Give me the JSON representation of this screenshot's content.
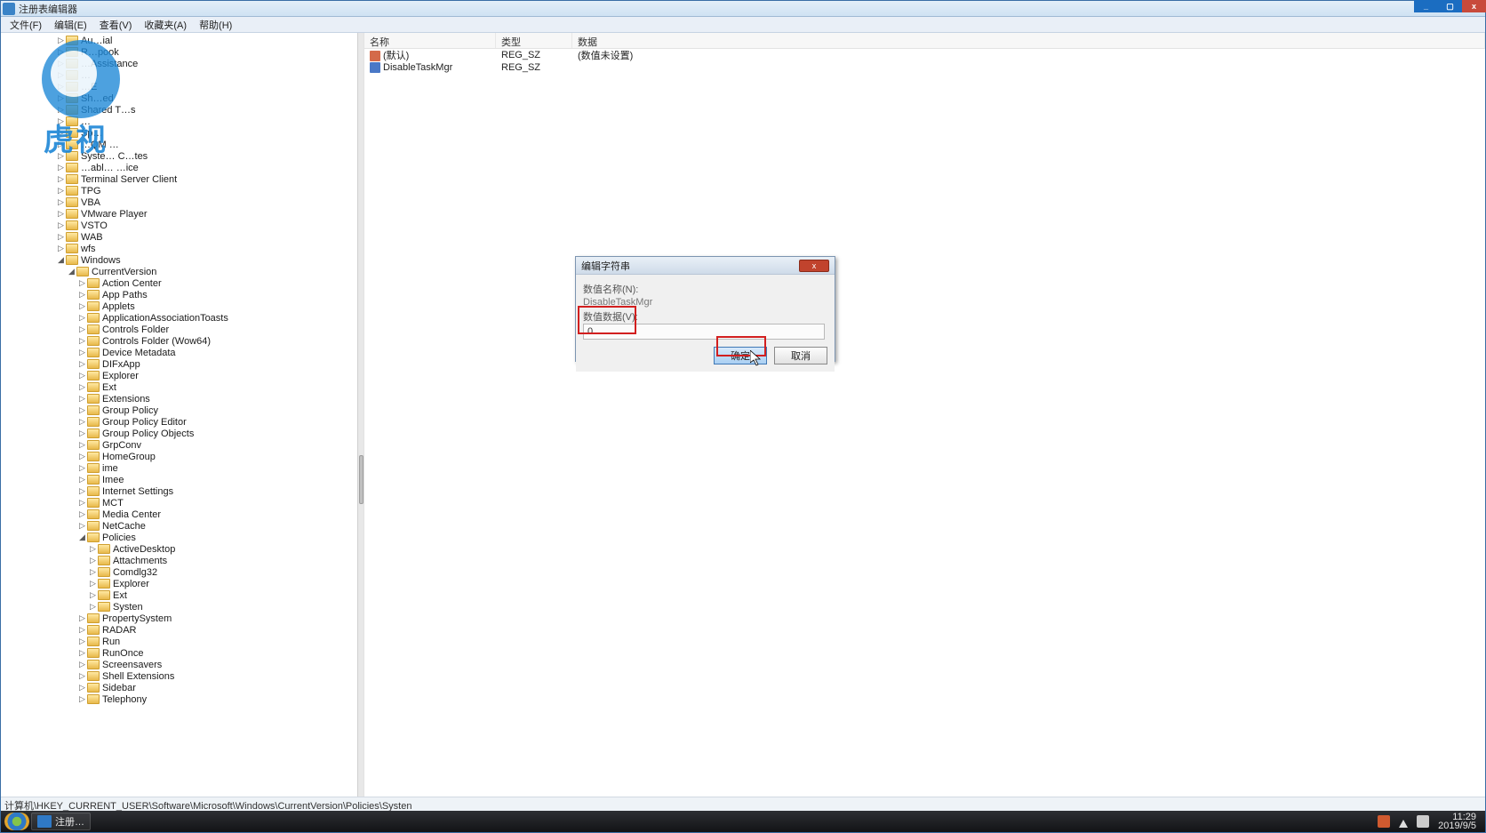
{
  "window": {
    "title": "注册表编辑器"
  },
  "winbtns": {
    "min": "_",
    "max": "▢",
    "close": "x"
  },
  "menu": {
    "file": "文件(F)",
    "edit": "编辑(E)",
    "view": "查看(V)",
    "fav": "收藏夹(A)",
    "help": "帮助(H)"
  },
  "tree": [
    {
      "d": 60,
      "e": "▷",
      "l": "Au…ial"
    },
    {
      "d": 60,
      "e": "▷",
      "l": "R…pook"
    },
    {
      "d": 60,
      "e": "▷",
      "l": "…Assistance"
    },
    {
      "d": 60,
      "e": "▷",
      "l": "…"
    },
    {
      "d": 60,
      "e": "▷",
      "l": "…E"
    },
    {
      "d": 60,
      "e": "▷",
      "l": "Sh…ed"
    },
    {
      "d": 60,
      "e": "▷",
      "l": "Shared T…s"
    },
    {
      "d": 60,
      "e": "▷",
      "l": "…"
    },
    {
      "d": 60,
      "e": "▷",
      "l": "Sp…"
    },
    {
      "d": 60,
      "e": "▷",
      "l": "…QM …"
    },
    {
      "d": 60,
      "e": "▷",
      "l": "Syste… C…tes"
    },
    {
      "d": 60,
      "e": "▷",
      "l": "…abl… …ice"
    },
    {
      "d": 60,
      "e": "▷",
      "l": "Terminal Server Client"
    },
    {
      "d": 60,
      "e": "▷",
      "l": "TPG"
    },
    {
      "d": 60,
      "e": "▷",
      "l": "VBA"
    },
    {
      "d": 60,
      "e": "▷",
      "l": "VMware Player"
    },
    {
      "d": 60,
      "e": "▷",
      "l": "VSTO"
    },
    {
      "d": 60,
      "e": "▷",
      "l": "WAB"
    },
    {
      "d": 60,
      "e": "▷",
      "l": "wfs"
    },
    {
      "d": 60,
      "e": "◢",
      "l": "Windows"
    },
    {
      "d": 72,
      "e": "◢",
      "l": "CurrentVersion"
    },
    {
      "d": 84,
      "e": "▷",
      "l": "Action Center"
    },
    {
      "d": 84,
      "e": "▷",
      "l": "App Paths"
    },
    {
      "d": 84,
      "e": "▷",
      "l": "Applets"
    },
    {
      "d": 84,
      "e": "▷",
      "l": "ApplicationAssociationToasts"
    },
    {
      "d": 84,
      "e": "▷",
      "l": "Controls Folder"
    },
    {
      "d": 84,
      "e": "▷",
      "l": "Controls Folder (Wow64)"
    },
    {
      "d": 84,
      "e": "▷",
      "l": "Device Metadata"
    },
    {
      "d": 84,
      "e": "▷",
      "l": "DIFxApp"
    },
    {
      "d": 84,
      "e": "▷",
      "l": "Explorer"
    },
    {
      "d": 84,
      "e": "▷",
      "l": "Ext"
    },
    {
      "d": 84,
      "e": "▷",
      "l": "Extensions"
    },
    {
      "d": 84,
      "e": "▷",
      "l": "Group Policy"
    },
    {
      "d": 84,
      "e": "▷",
      "l": "Group Policy Editor"
    },
    {
      "d": 84,
      "e": "▷",
      "l": "Group Policy Objects"
    },
    {
      "d": 84,
      "e": "▷",
      "l": "GrpConv"
    },
    {
      "d": 84,
      "e": "▷",
      "l": "HomeGroup"
    },
    {
      "d": 84,
      "e": "▷",
      "l": "ime"
    },
    {
      "d": 84,
      "e": "▷",
      "l": "Imee"
    },
    {
      "d": 84,
      "e": "▷",
      "l": "Internet Settings"
    },
    {
      "d": 84,
      "e": "▷",
      "l": "MCT"
    },
    {
      "d": 84,
      "e": "▷",
      "l": "Media Center"
    },
    {
      "d": 84,
      "e": "▷",
      "l": "NetCache"
    },
    {
      "d": 84,
      "e": "◢",
      "l": "Policies"
    },
    {
      "d": 96,
      "e": "▷",
      "l": "ActiveDesktop"
    },
    {
      "d": 96,
      "e": "▷",
      "l": "Attachments"
    },
    {
      "d": 96,
      "e": "▷",
      "l": "Comdlg32"
    },
    {
      "d": 96,
      "e": "▷",
      "l": "Explorer"
    },
    {
      "d": 96,
      "e": "▷",
      "l": "Ext"
    },
    {
      "d": 96,
      "e": "▷",
      "l": "Systen"
    },
    {
      "d": 84,
      "e": "▷",
      "l": "PropertySystem"
    },
    {
      "d": 84,
      "e": "▷",
      "l": "RADAR"
    },
    {
      "d": 84,
      "e": "▷",
      "l": "Run"
    },
    {
      "d": 84,
      "e": "▷",
      "l": "RunOnce"
    },
    {
      "d": 84,
      "e": "▷",
      "l": "Screensavers"
    },
    {
      "d": 84,
      "e": "▷",
      "l": "Shell Extensions"
    },
    {
      "d": 84,
      "e": "▷",
      "l": "Sidebar"
    },
    {
      "d": 84,
      "e": "▷",
      "l": "Telephony"
    }
  ],
  "list": {
    "headers": {
      "name": "名称",
      "type": "类型",
      "data": "数据"
    },
    "rows": [
      {
        "icon": "str",
        "name": "(默认)",
        "type": "REG_SZ",
        "data": "(数值未设置)"
      },
      {
        "icon": "bin",
        "name": "DisableTaskMgr",
        "type": "REG_SZ",
        "data": ""
      }
    ]
  },
  "statusbar": {
    "path": "计算机\\HKEY_CURRENT_USER\\Software\\Microsoft\\Windows\\CurrentVersion\\Policies\\Systen"
  },
  "dialog": {
    "title": "编辑字符串",
    "name_label": "数值名称(N):",
    "name_value": "DisableTaskMgr",
    "data_label": "数值数据(V):",
    "data_value": "0",
    "ok": "确定",
    "cancel": "取消",
    "close": "x"
  },
  "taskbar": {
    "app": "注册…",
    "time": "11:29",
    "date": "2019/9/5"
  },
  "watermark": {
    "text": "虎视"
  }
}
